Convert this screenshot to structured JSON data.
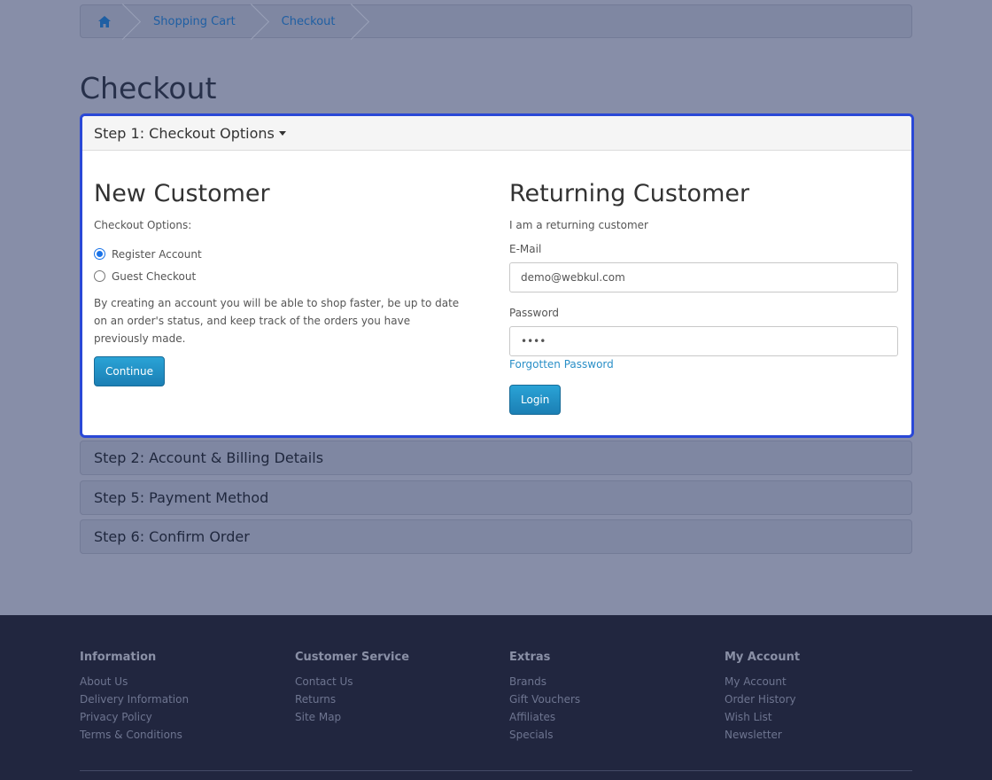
{
  "breadcrumb": {
    "items": [
      "Shopping Cart",
      "Checkout"
    ]
  },
  "page_title": "Checkout",
  "step1": {
    "title": "Step 1: Checkout Options",
    "new_customer": {
      "heading": "New Customer",
      "options_label": "Checkout Options:",
      "register_label": "Register Account",
      "guest_label": "Guest Checkout",
      "selected": "register",
      "description": "By creating an account you will be able to shop faster, be up to date on an order's status, and keep track of the orders you have previously made.",
      "continue_label": "Continue"
    },
    "returning_customer": {
      "heading": "Returning Customer",
      "subtitle": "I am a returning customer",
      "email_label": "E-Mail",
      "email_value": "demo@webkul.com",
      "password_label": "Password",
      "password_value": "••••",
      "forgot_label": "Forgotten Password",
      "login_label": "Login"
    }
  },
  "steps": {
    "step2": "Step 2: Account & Billing Details",
    "step5": "Step 5: Payment Method",
    "step6": "Step 6: Confirm Order"
  },
  "footer": {
    "information": {
      "heading": "Information",
      "links": [
        "About Us",
        "Delivery Information",
        "Privacy Policy",
        "Terms & Conditions"
      ]
    },
    "customer_service": {
      "heading": "Customer Service",
      "links": [
        "Contact Us",
        "Returns",
        "Site Map"
      ]
    },
    "extras": {
      "heading": "Extras",
      "links": [
        "Brands",
        "Gift Vouchers",
        "Affiliates",
        "Specials"
      ]
    },
    "my_account": {
      "heading": "My Account",
      "links": [
        "My Account",
        "Order History",
        "Wish List",
        "Newsletter"
      ]
    }
  },
  "colors": {
    "overlay_bg": "#878ea8",
    "active_border": "#2a48d6",
    "button": "#1f8fc6",
    "footer_bg": "#21263f"
  }
}
